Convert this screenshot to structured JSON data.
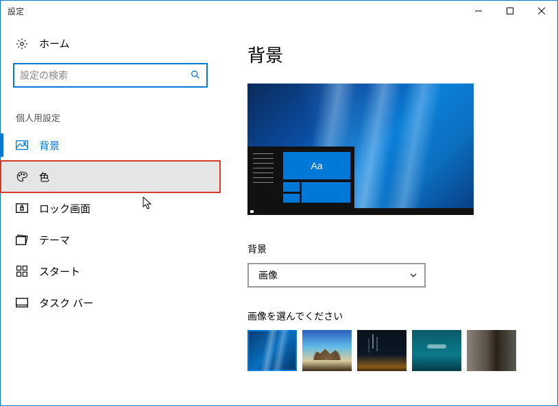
{
  "window": {
    "title": "設定"
  },
  "sidebar": {
    "home_label": "ホーム",
    "search_placeholder": "設定の検索",
    "section_label": "個人用設定",
    "items": [
      {
        "label": "背景"
      },
      {
        "label": "色"
      },
      {
        "label": "ロック画面"
      },
      {
        "label": "テーマ"
      },
      {
        "label": "スタート"
      },
      {
        "label": "タスク バー"
      }
    ]
  },
  "main": {
    "title": "背景",
    "preview_tile_text": "Aa",
    "background_field_label": "背景",
    "background_select_value": "画像",
    "choose_image_label": "画像を選んでください"
  }
}
